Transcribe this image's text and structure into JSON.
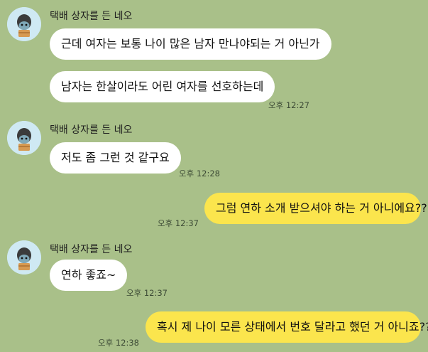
{
  "sender": {
    "name": "택배 상자를 든 네오"
  },
  "messages": {
    "m1": {
      "text": "근데 여자는 보통 나이 많은 남자 만나야되는 거 아닌가"
    },
    "m2": {
      "text": "남자는 한살이라도 어린 여자를 선호하는데",
      "time": "오후 12:27"
    },
    "m3": {
      "text": "저도 좀 그런 것 같구요",
      "time": "오후 12:28"
    },
    "m4": {
      "text": "그럼 연하 소개 받으셔야 하는 거 아니에요??",
      "time": "오후 12:37"
    },
    "m5": {
      "text": "연하 좋죠~",
      "time": "오후 12:37"
    },
    "m6": {
      "text": "혹시 제 나이 모른 상태에서 번호 달라고 했던 거 아니죠??",
      "time": "오후 12:38"
    }
  },
  "colors": {
    "background": "#a9c089",
    "incoming_bubble": "#ffffff",
    "outgoing_bubble": "#fbe54d"
  },
  "icons": {
    "avatar": "neo-holding-box-avatar-icon"
  }
}
